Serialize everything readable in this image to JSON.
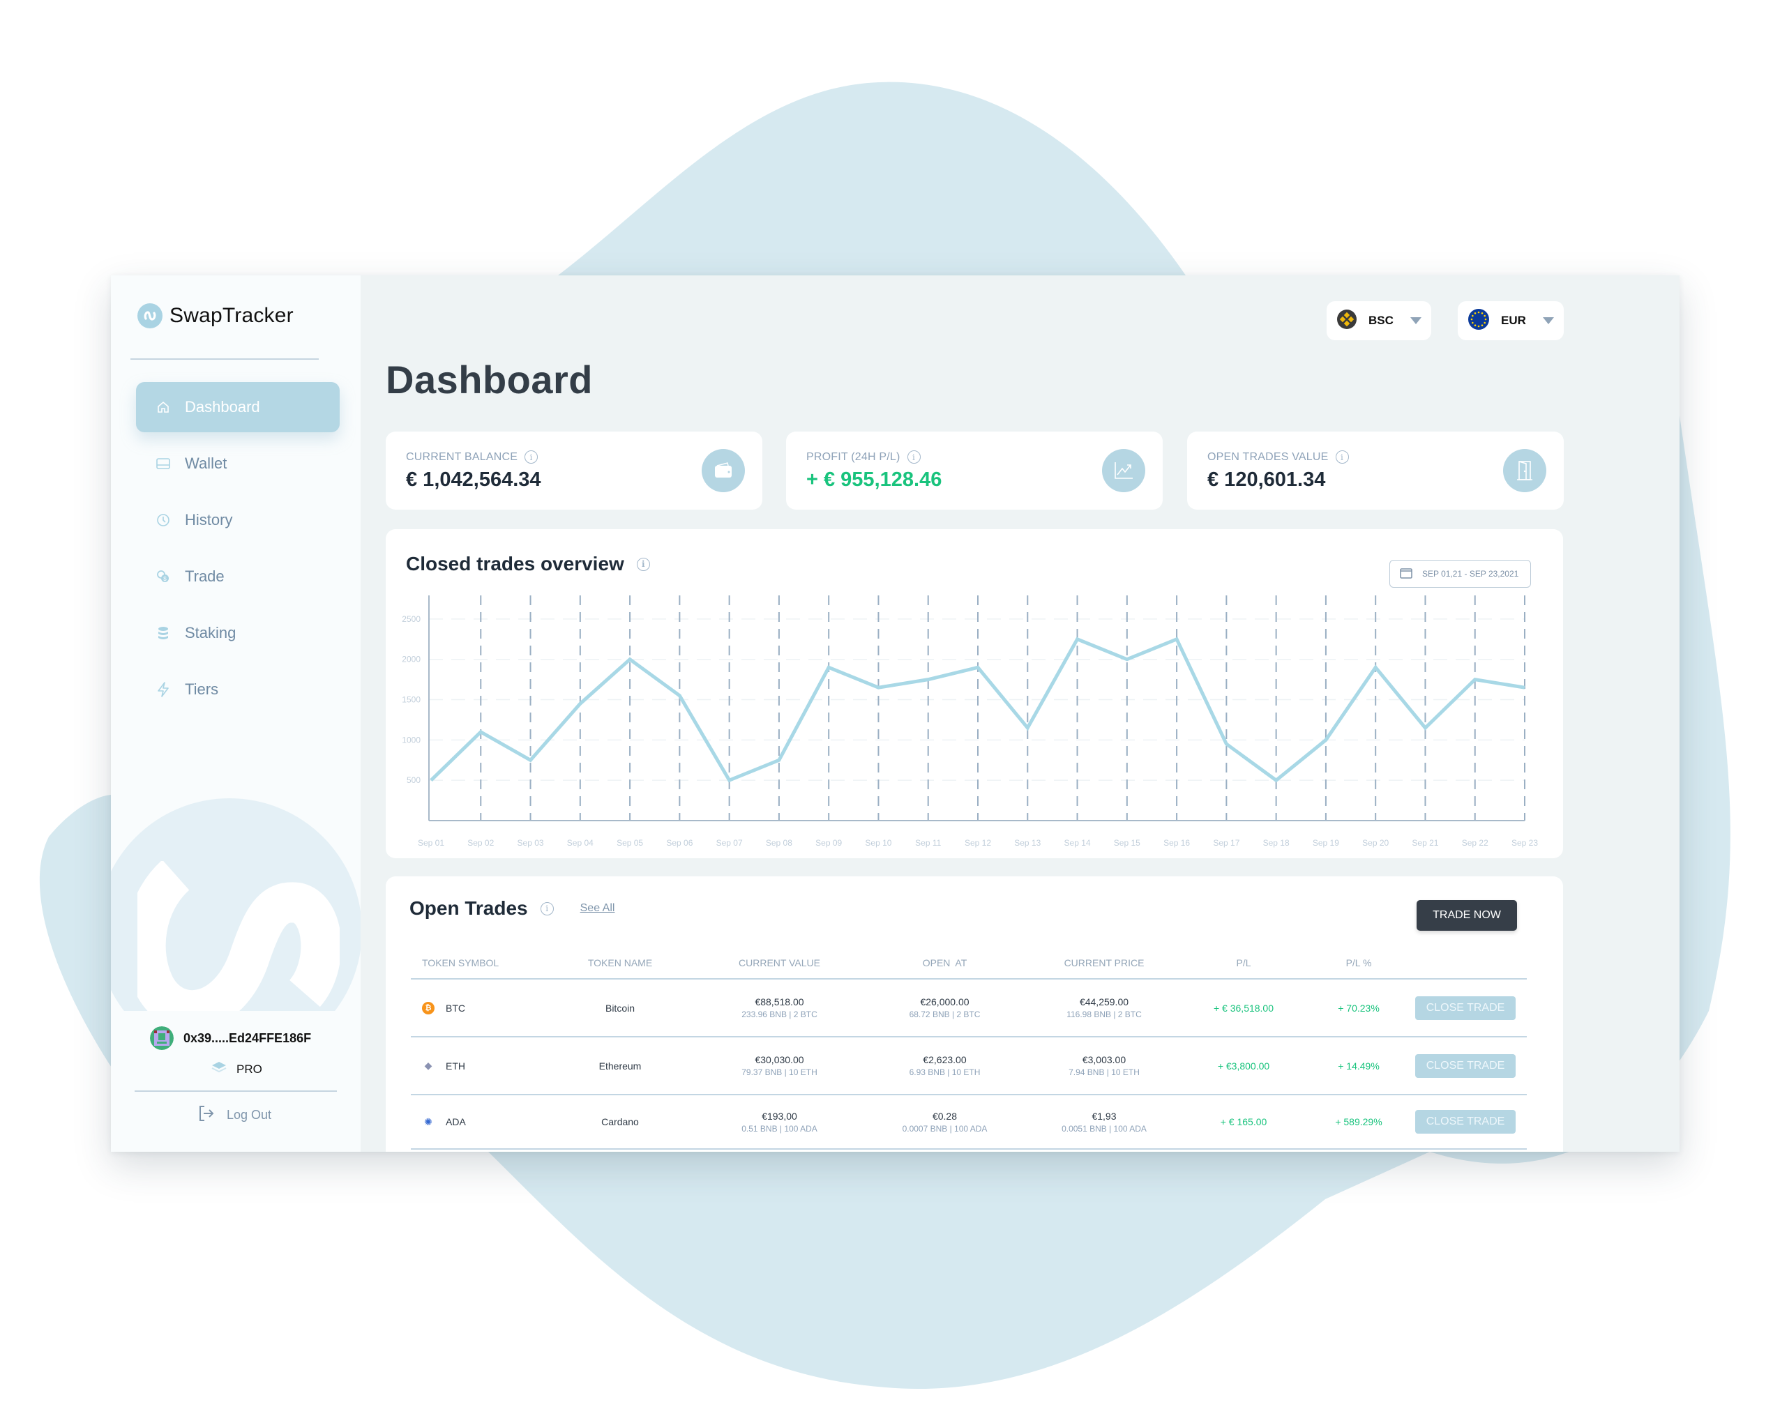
{
  "app": {
    "name": "SwapTracker"
  },
  "sidebar": {
    "items": [
      {
        "label": "Dashboard",
        "icon": "home-icon",
        "active": true
      },
      {
        "label": "Wallet",
        "icon": "wallet-icon",
        "active": false
      },
      {
        "label": "History",
        "icon": "clock-icon",
        "active": false
      },
      {
        "label": "Trade",
        "icon": "coins-icon",
        "active": false
      },
      {
        "label": "Staking",
        "icon": "database-icon",
        "active": false
      },
      {
        "label": "Tiers",
        "icon": "lightning-icon",
        "active": false
      }
    ],
    "user": {
      "wallet_address": "0x39.....Ed24FFE186F",
      "tier": "PRO"
    },
    "logout_label": "Log Out"
  },
  "header": {
    "network": {
      "selected": "BSC",
      "icon": "binance-icon"
    },
    "currency": {
      "selected": "EUR",
      "icon": "eu-flag-icon"
    },
    "page_title": "Dashboard"
  },
  "stats": [
    {
      "label": "CURRENT BALANCE",
      "value": "€ 1,042,564.34",
      "icon": "wallet-icon",
      "positive": false
    },
    {
      "label": "PROFIT (24H P/L)",
      "value": "+ € 955,128.46",
      "icon": "trend-up-icon",
      "positive": true
    },
    {
      "label": "OPEN TRADES VALUE",
      "value": "€ 120,601.34",
      "icon": "door-icon",
      "positive": false
    }
  ],
  "chart_card": {
    "title": "Closed trades overview",
    "date_range": "SEP 01,21 - SEP 23,2021"
  },
  "chart_data": {
    "type": "line",
    "title": "Closed trades overview",
    "xlabel": "",
    "ylabel": "",
    "categories": [
      "Sep 01",
      "Sep 02",
      "Sep 03",
      "Sep 04",
      "Sep 05",
      "Sep 06",
      "Sep 07",
      "Sep 08",
      "Sep 09",
      "Sep 10",
      "Sep 11",
      "Sep 12",
      "Sep 13",
      "Sep 14",
      "Sep 15",
      "Sep 16",
      "Sep 17",
      "Sep 18",
      "Sep 19",
      "Sep 20",
      "Sep 21",
      "Sep 22",
      "Sep 23"
    ],
    "series": [
      {
        "name": "Closed trades",
        "color": "#a8d8e6",
        "values": [
          500,
          1100,
          750,
          1450,
          2000,
          1550,
          500,
          750,
          1900,
          1650,
          1750,
          1900,
          1150,
          2250,
          2000,
          2250,
          950,
          500,
          1000,
          1900,
          1150,
          1750,
          1650
        ]
      }
    ],
    "yticks": [
      500,
      1000,
      1500,
      2000,
      2500
    ],
    "ylim": [
      0,
      2750
    ],
    "grid": true,
    "legend": "none"
  },
  "trades": {
    "title": "Open Trades",
    "see_all": "See All",
    "trade_now": "TRADE NOW",
    "columns": [
      "TOKEN SYMBOL",
      "TOKEN NAME",
      "CURRENT VALUE",
      "OPEN  AT",
      "CURRENT PRICE",
      "P/L",
      "P/L %",
      ""
    ],
    "close_label": "CLOSE TRADE",
    "rows": [
      {
        "symbol": "BTC",
        "name": "Bitcoin",
        "coin_color": "#f7931a",
        "coin_glyph": "₿",
        "current_value": "€88,518.00",
        "current_value_sub": "233.96 BNB | 2 BTC",
        "open_at": "€26,000.00",
        "open_at_sub": "68.72 BNB | 2 BTC",
        "current_price": "€44,259.00",
        "current_price_sub": "116.98 BNB | 2 BTC",
        "pl": "+ € 36,518.00",
        "pl_pct": "+ 70.23%"
      },
      {
        "symbol": "ETH",
        "name": "Ethereum",
        "coin_color": "#8a92b2",
        "coin_glyph": "◆",
        "current_value": "€30,030.00",
        "current_value_sub": "79.37 BNB | 10 ETH",
        "open_at": "€2,623.00",
        "open_at_sub": "6.93 BNB | 10 ETH",
        "current_price": "€3,003.00",
        "current_price_sub": "7.94 BNB | 10 ETH",
        "pl": "+ €3,800.00",
        "pl_pct": "+ 14.49%"
      },
      {
        "symbol": "ADA",
        "name": "Cardano",
        "coin_color": "#3468d1",
        "coin_glyph": "✺",
        "current_value": "€193,00",
        "current_value_sub": "0.51 BNB | 100 ADA",
        "open_at": "€0.28",
        "open_at_sub": "0.0007 BNB | 100 ADA",
        "current_price": "€1,93",
        "current_price_sub": "0.0051 BNB | 100 ADA",
        "pl": "+ € 165.00",
        "pl_pct": "+ 589.29%"
      }
    ]
  },
  "colors": {
    "accent": "#b4d7e4",
    "positive": "#19c37d",
    "dark_button": "#363e48",
    "background_blob": "#d6e9f0"
  }
}
